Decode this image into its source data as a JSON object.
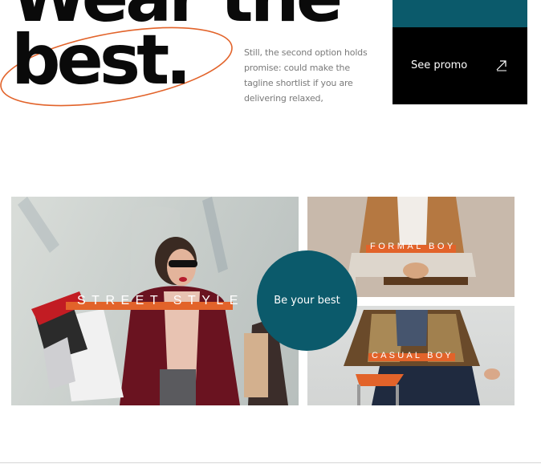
{
  "hero": {
    "line1": "Wear the",
    "line2": "best."
  },
  "tagline": "Still, the second option holds promise: could make the tagline shortlist if you are delivering relaxed,",
  "promo": {
    "label": "See promo",
    "icon": "arrow-up-right-icon"
  },
  "gallery": {
    "street": {
      "label": "STREET STYLE"
    },
    "formal": {
      "label": "FORMAL BOY"
    },
    "casual": {
      "label": "CASUAL BOY"
    },
    "cta": "Be your best"
  },
  "colors": {
    "accent_orange": "#e2632a",
    "teal": "#0b5a6b",
    "black": "#000000"
  }
}
